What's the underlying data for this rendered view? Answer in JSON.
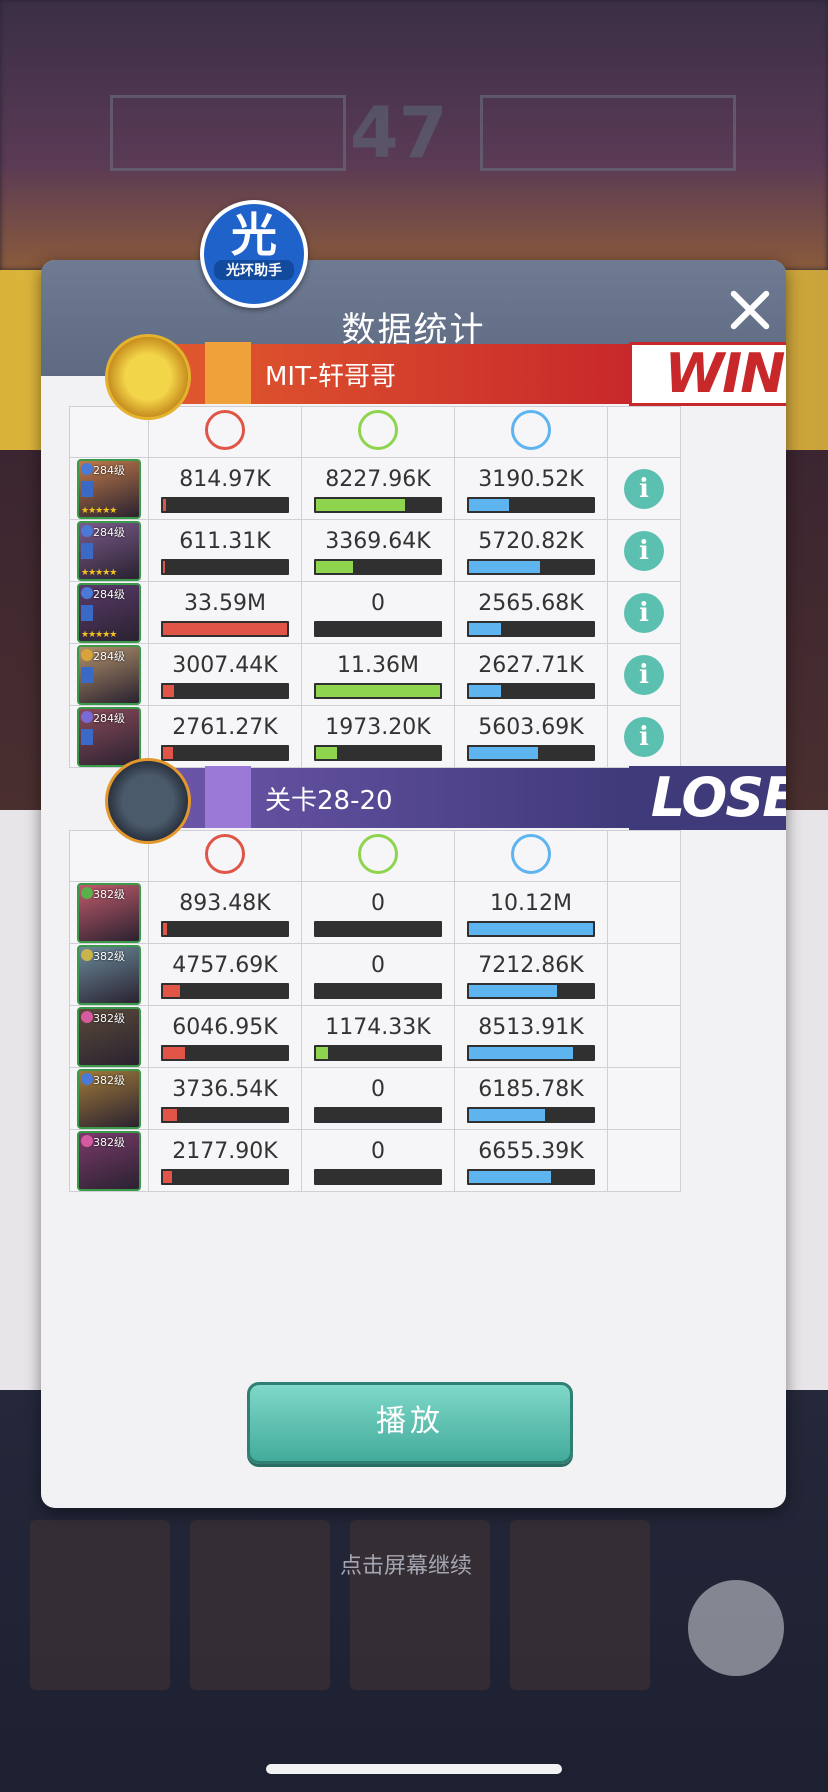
{
  "dialog": {
    "title": "数据统计",
    "close_icon": "close-icon"
  },
  "badge": {
    "glyph": "光",
    "label": "光环助手"
  },
  "background": {
    "score": "47",
    "hint": "点击屏幕继续"
  },
  "stat_icons": [
    "damage-icon",
    "heal-icon",
    "shield-icon"
  ],
  "colors": {
    "damage": "#e05548",
    "heal": "#8fd44e",
    "shield": "#5eb4ef",
    "win": "#c8282a",
    "lose": "#3f3a7a"
  },
  "teams": [
    {
      "name": "MIT-轩哥哥",
      "result": "WIN",
      "heroes": [
        {
          "level": "284级",
          "stars": "★★★★★",
          "damage": "814.97K",
          "heal": "8227.96K",
          "shield": "3190.52K",
          "damage_frac": 0.024,
          "heal_frac": 0.72,
          "shield_frac": 0.32
        },
        {
          "level": "284级",
          "stars": "★★★★★",
          "damage": "611.31K",
          "heal": "3369.64K",
          "shield": "5720.82K",
          "damage_frac": 0.018,
          "heal_frac": 0.3,
          "shield_frac": 0.57
        },
        {
          "level": "284级",
          "stars": "★★★★★",
          "damage": "33.59M",
          "heal": "0",
          "shield": "2565.68K",
          "damage_frac": 1.0,
          "heal_frac": 0,
          "shield_frac": 0.26
        },
        {
          "level": "284级",
          "stars": "",
          "damage": "3007.44K",
          "heal": "11.36M",
          "shield": "2627.71K",
          "damage_frac": 0.09,
          "heal_frac": 1.0,
          "shield_frac": 0.26
        },
        {
          "level": "284级",
          "stars": "",
          "damage": "2761.27K",
          "heal": "1973.20K",
          "shield": "5603.69K",
          "damage_frac": 0.08,
          "heal_frac": 0.17,
          "shield_frac": 0.56
        }
      ]
    },
    {
      "name": "关卡28-20",
      "result": "LOSE",
      "heroes": [
        {
          "level": "382级",
          "damage": "893.48K",
          "heal": "0",
          "shield": "10.12M",
          "damage_frac": 0.03,
          "heal_frac": 0,
          "shield_frac": 1.0
        },
        {
          "level": "382级",
          "damage": "4757.69K",
          "heal": "0",
          "shield": "7212.86K",
          "damage_frac": 0.14,
          "heal_frac": 0,
          "shield_frac": 0.71
        },
        {
          "level": "382级",
          "damage": "6046.95K",
          "heal": "1174.33K",
          "shield": "8513.91K",
          "damage_frac": 0.18,
          "heal_frac": 0.1,
          "shield_frac": 0.84
        },
        {
          "level": "382级",
          "damage": "3736.54K",
          "heal": "0",
          "shield": "6185.78K",
          "damage_frac": 0.11,
          "heal_frac": 0,
          "shield_frac": 0.61
        },
        {
          "level": "382级",
          "damage": "2177.90K",
          "heal": "0",
          "shield": "6655.39K",
          "damage_frac": 0.07,
          "heal_frac": 0,
          "shield_frac": 0.66
        }
      ]
    }
  ],
  "play_button": "播放"
}
